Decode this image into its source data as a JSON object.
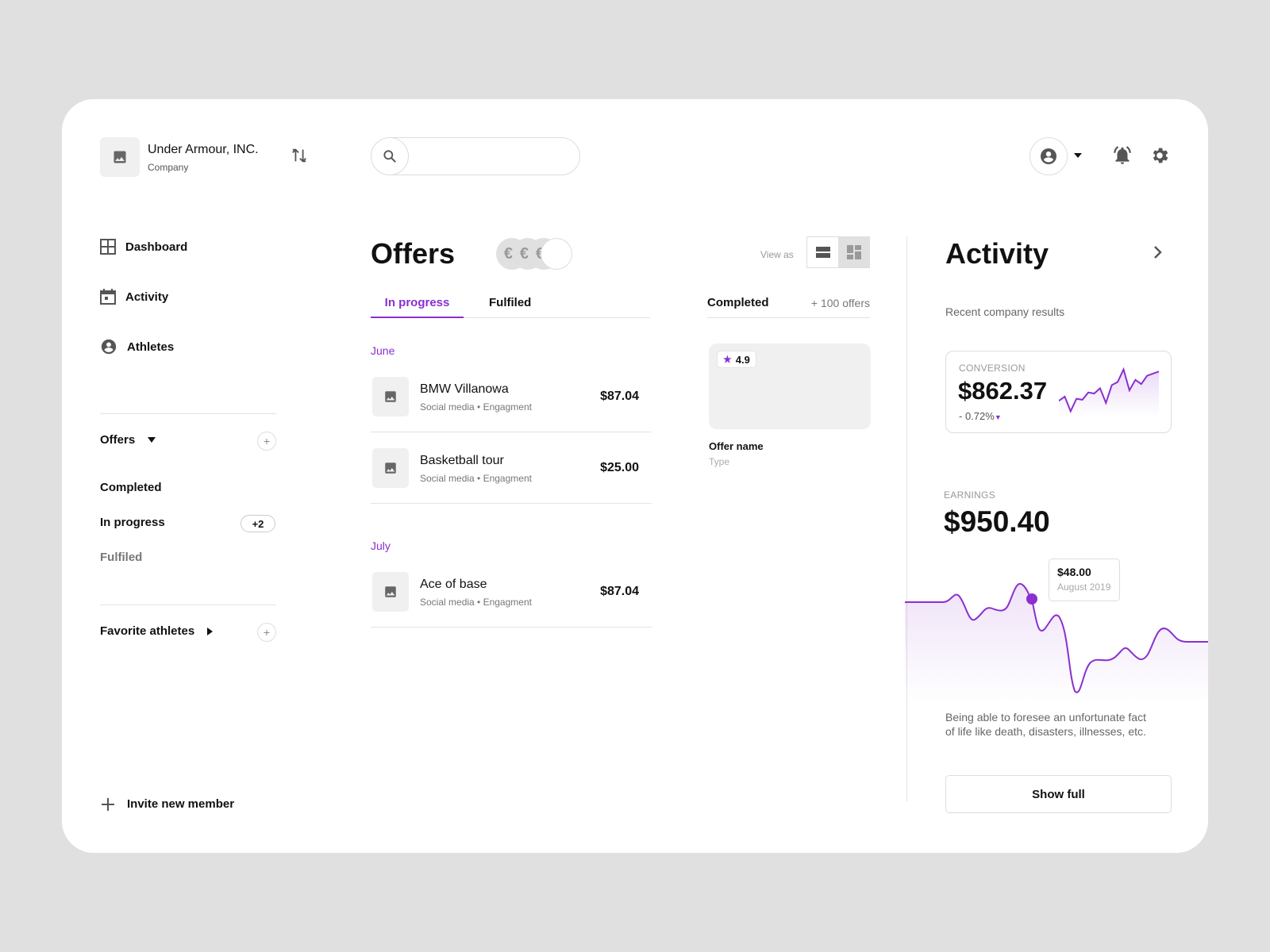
{
  "colors": {
    "accent": "#8a2fd0",
    "muted": "#777777",
    "border": "#dddddd",
    "placeholder_bg": "#f0f0f0"
  },
  "header": {
    "company_name": "Under Armour, INC.",
    "company_type": "Company",
    "search": {
      "value": "",
      "placeholder": ""
    },
    "icons": [
      "image-icon",
      "switch-icon",
      "search-icon",
      "account-icon",
      "caret-down-icon",
      "bell-icon",
      "gear-icon"
    ]
  },
  "sidebar": {
    "nav": [
      {
        "label": "Dashboard",
        "icon": "dashboard-icon"
      },
      {
        "label": "Activity",
        "icon": "calendar-icon"
      },
      {
        "label": "Athletes",
        "icon": "account-icon"
      }
    ],
    "offers_section": {
      "label": "Offers",
      "items": [
        {
          "label": "Completed",
          "badge": null
        },
        {
          "label": "In progress",
          "badge": "+2"
        },
        {
          "label": "Fulfiled",
          "badge": null
        }
      ]
    },
    "favorites_section": {
      "label": "Favorite athletes"
    },
    "invite_label": "Invite new member"
  },
  "offers": {
    "title": "Offers",
    "coin_glyph": "€",
    "view_as_label": "View as",
    "tabs": [
      {
        "label": "In progress",
        "active": true
      },
      {
        "label": "Fulfiled",
        "active": false
      }
    ],
    "groups": [
      {
        "month": "June",
        "rows": [
          {
            "name": "BMW Villanowa",
            "meta": "Social media • Engagment",
            "price": "$87.04"
          },
          {
            "name": "Basketball tour",
            "meta": "Social media • Engagment",
            "price": "$25.00"
          }
        ]
      },
      {
        "month": "July",
        "rows": [
          {
            "name": "Ace of base",
            "meta": "Social media • Engagment",
            "price": "$87.04"
          }
        ]
      }
    ],
    "completed": {
      "title": "Completed",
      "count": "+ 100 offers",
      "card": {
        "rating": "4.9",
        "name": "Offer name",
        "type": "Type"
      }
    }
  },
  "activity": {
    "title": "Activity",
    "subtitle": "Recent company results",
    "conversion": {
      "label": "CONVERSION",
      "value": "$862.37",
      "delta": "- 0.72%",
      "sparkline": [
        40,
        44,
        30,
        42,
        41,
        48,
        47,
        52,
        38,
        55,
        58,
        70,
        50,
        60,
        56,
        64,
        66,
        68
      ]
    },
    "earnings": {
      "label": "EARNINGS",
      "value": "$950.40",
      "tooltip_value": "$48.00",
      "tooltip_date": "August 2019",
      "description": "Being able to foresee an unfortunate fact of life like death, disasters, illnesses, etc.",
      "show_full_label": "Show full"
    }
  }
}
